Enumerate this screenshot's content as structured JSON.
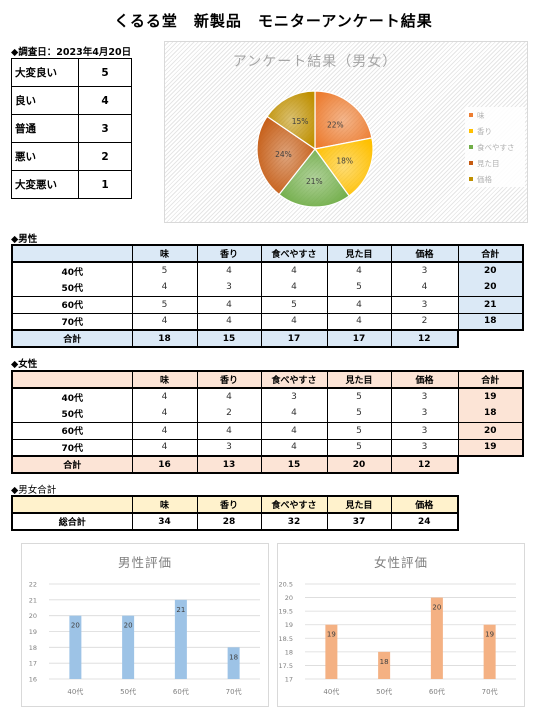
{
  "title": "くるる堂　新製品　モニターアンケート結果",
  "survey_date": "◆調査日：2023年4月20日",
  "rating_scale": [
    {
      "label": "大変良い",
      "value": "5"
    },
    {
      "label": "良い",
      "value": "4"
    },
    {
      "label": "普通",
      "value": "3"
    },
    {
      "label": "悪い",
      "value": "2"
    },
    {
      "label": "大変悪い",
      "value": "1"
    }
  ],
  "columns": [
    "",
    "味",
    "香り",
    "食べやすさ",
    "見た目",
    "価格",
    "合計"
  ],
  "male": {
    "section_label": "◆男性",
    "rows": [
      {
        "age": "40代",
        "values": [
          "5",
          "4",
          "4",
          "4",
          "3"
        ],
        "total": "20"
      },
      {
        "age": "50代",
        "values": [
          "4",
          "3",
          "4",
          "5",
          "4"
        ],
        "total": "20"
      },
      {
        "age": "60代",
        "values": [
          "5",
          "4",
          "5",
          "4",
          "3"
        ],
        "total": "21"
      },
      {
        "age": "70代",
        "values": [
          "4",
          "4",
          "4",
          "4",
          "2"
        ],
        "total": "18"
      }
    ],
    "sum_label": "合計",
    "sums": [
      "18",
      "15",
      "17",
      "17",
      "12"
    ]
  },
  "female": {
    "section_label": "◆女性",
    "rows": [
      {
        "age": "40代",
        "values": [
          "4",
          "4",
          "3",
          "5",
          "3"
        ],
        "total": "19"
      },
      {
        "age": "50代",
        "values": [
          "4",
          "2",
          "4",
          "5",
          "3"
        ],
        "total": "18"
      },
      {
        "age": "60代",
        "values": [
          "4",
          "4",
          "4",
          "5",
          "3"
        ],
        "total": "20"
      },
      {
        "age": "70代",
        "values": [
          "4",
          "3",
          "4",
          "5",
          "3"
        ],
        "total": "19"
      }
    ],
    "sum_label": "合計",
    "sums": [
      "16",
      "13",
      "15",
      "20",
      "12"
    ]
  },
  "combined": {
    "section_label": "◆男女合計",
    "row_label": "総合計",
    "values": [
      "34",
      "28",
      "32",
      "37",
      "24"
    ]
  },
  "chart_data": [
    {
      "type": "pie",
      "title": "アンケート結果（男女）",
      "categories": [
        "味",
        "香り",
        "食べやすさ",
        "見た目",
        "価格"
      ],
      "values": [
        34,
        28,
        32,
        37,
        24
      ],
      "data_labels": [
        "22%",
        "18%",
        "21%",
        "24%",
        "15%"
      ],
      "colors": [
        "#ed7d31",
        "#ffc000",
        "#70ad47",
        "#c55a11",
        "#bf9000"
      ],
      "legend": "right"
    },
    {
      "type": "bar",
      "title": "男性評価",
      "categories": [
        "40代",
        "50代",
        "60代",
        "70代"
      ],
      "values": [
        20,
        20,
        21,
        18
      ],
      "ylim": [
        16,
        22
      ],
      "yticks": [
        "16",
        "17",
        "18",
        "19",
        "20",
        "21",
        "22"
      ],
      "color": "#9dc3e6",
      "grid": true
    },
    {
      "type": "bar",
      "title": "女性評価",
      "categories": [
        "40代",
        "50代",
        "60代",
        "70代"
      ],
      "values": [
        19,
        18,
        20,
        19
      ],
      "ylim": [
        17,
        20.5
      ],
      "yticks": [
        "17",
        "17.5",
        "18",
        "18.5",
        "19",
        "19.5",
        "20",
        "20.5"
      ],
      "color": "#f4b183",
      "grid": true
    }
  ]
}
